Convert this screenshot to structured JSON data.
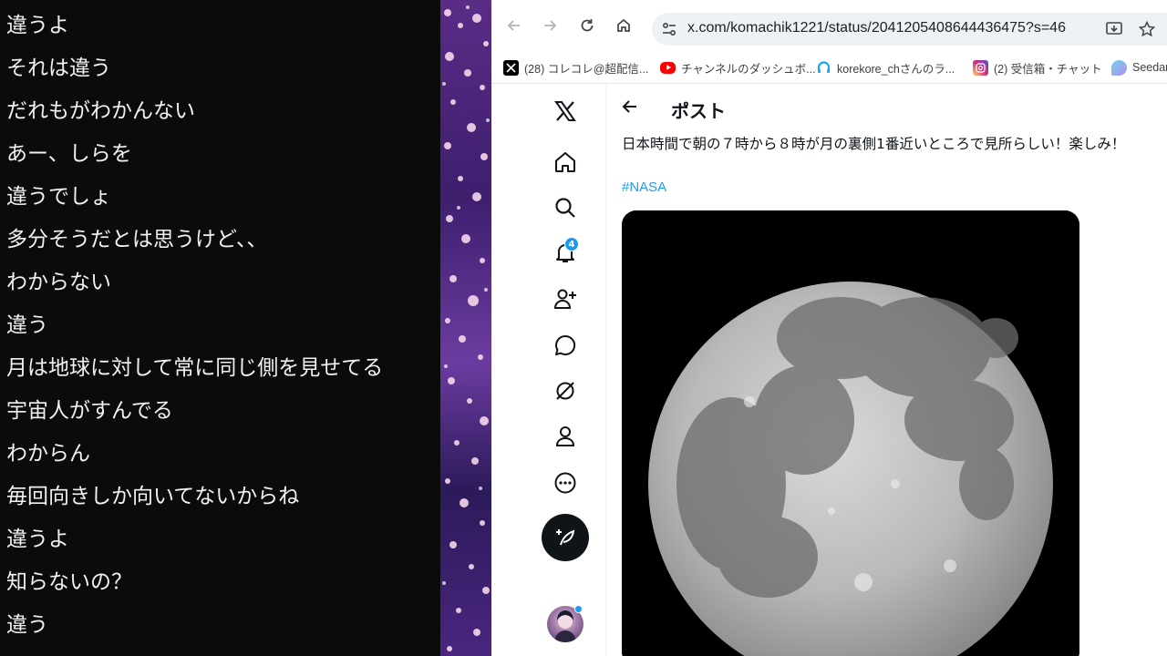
{
  "chat": {
    "lines": [
      "違うよ",
      "それは違う",
      "だれもがわかんない",
      "あー、しらを",
      "違うでしょ",
      "多分そうだとは思うけど、、",
      "わからない",
      "違う",
      "月は地球に対して常に同じ側を見せてる",
      "宇宙人がすんでる",
      "わからん",
      "毎回向きしか向いてないからね",
      "違うよ",
      "知らないの？",
      "違う"
    ]
  },
  "browser": {
    "url": "x.com/komachik1221/status/2041205408644436475?s=46",
    "bookmarks": [
      {
        "label": "(28) コレコレ@超配信...",
        "icon": "x-icon",
        "color": "#000000"
      },
      {
        "label": "チャンネルのダッシュボ...",
        "icon": "youtube-icon",
        "color": "#ff0000"
      },
      {
        "label": "korekore_chさんのラ...",
        "icon": "headset-icon",
        "color": "#1aa7ec"
      },
      {
        "label": "(2) 受信箱・チャット",
        "icon": "instagram-icon",
        "color": "#d62976"
      },
      {
        "label": "Seedan",
        "icon": "seed-icon",
        "color": "#6fd3e8"
      }
    ]
  },
  "x": {
    "notification_count": "4",
    "post_title": "ポスト",
    "post_text": "日本時間で朝の７時から８時が月の裏側1番近いところで見所らしい！楽しみ！",
    "hashtag": "#NASA",
    "accent_color": "#1d9bf0"
  }
}
